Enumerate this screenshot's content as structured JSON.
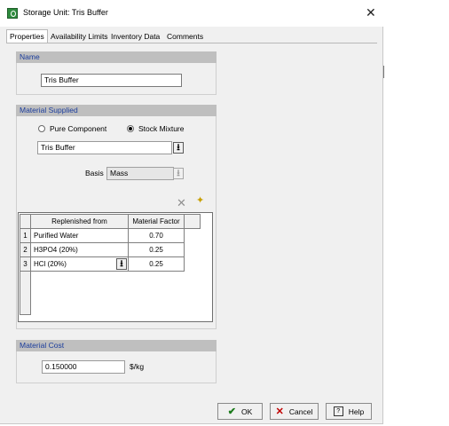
{
  "window": {
    "title": "Storage Unit: Tris Buffer"
  },
  "tabs": [
    "Properties",
    "Availability Limits",
    "Inventory Data",
    "Comments"
  ],
  "name_section": {
    "header": "Name",
    "value": "Tris Buffer"
  },
  "material_section": {
    "header": "Material Supplied",
    "radio_pure": "Pure Component",
    "radio_stock": "Stock Mixture",
    "selected_radio": "Stock Mixture",
    "material_value": "Tris Buffer",
    "basis_label": "Basis",
    "basis_value": "Mass",
    "grid": {
      "headers": [
        "Replenished from",
        "Material Factor"
      ],
      "rows": [
        {
          "num": "1",
          "source": "Purified Water",
          "factor": "0.70"
        },
        {
          "num": "2",
          "source": "H3PO4 (20%)",
          "factor": "0.25"
        },
        {
          "num": "3",
          "source": "HCl (20%)",
          "factor": "0.25"
        }
      ]
    }
  },
  "cost_section": {
    "header": "Material Cost",
    "value": "0.150000",
    "unit": "$/kg"
  },
  "buttons": {
    "ok": "OK",
    "cancel": "Cancel",
    "help": "Help"
  },
  "colors": {
    "section_header_bg": "#bfbfbf",
    "section_header_text": "#1a3c9c",
    "ok_check": "#1a7a1a",
    "cancel_x": "#c00000"
  }
}
